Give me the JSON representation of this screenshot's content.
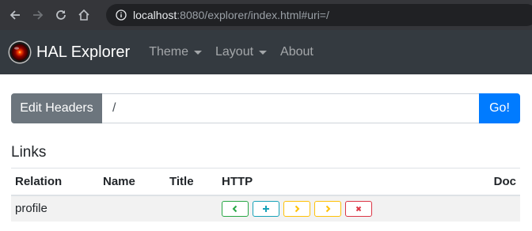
{
  "browser": {
    "url_host": "localhost",
    "url_rest": ":8080/explorer/index.html#uri=/"
  },
  "navbar": {
    "brand": "HAL Explorer",
    "menu": [
      {
        "label": "Theme",
        "dropdown": true
      },
      {
        "label": "Layout",
        "dropdown": true
      },
      {
        "label": "About",
        "dropdown": false
      }
    ]
  },
  "uri_bar": {
    "edit_headers_label": "Edit Headers",
    "uri_value": "/",
    "go_label": "Go!"
  },
  "links": {
    "heading": "Links",
    "columns": [
      "Relation",
      "Name",
      "Title",
      "HTTP",
      "Doc"
    ],
    "rows": [
      {
        "relation": "profile",
        "name": "",
        "title": "",
        "doc": ""
      }
    ],
    "http_buttons": [
      {
        "icon": "chevron-left-icon",
        "glyph": "‹",
        "color": "#28a745"
      },
      {
        "icon": "plus-icon",
        "glyph": "+",
        "color": "#17a2b8"
      },
      {
        "icon": "chevron-right-icon",
        "glyph": "›",
        "color": "#ffc107"
      },
      {
        "icon": "chevron-right-icon",
        "glyph": "›",
        "color": "#ffc107"
      },
      {
        "icon": "x-icon",
        "glyph": "×",
        "color": "#dc3545"
      }
    ]
  },
  "colors": {
    "browser_bg": "#35363a",
    "navbar_bg": "#343a40",
    "primary": "#007bff",
    "secondary": "#6c757d"
  }
}
